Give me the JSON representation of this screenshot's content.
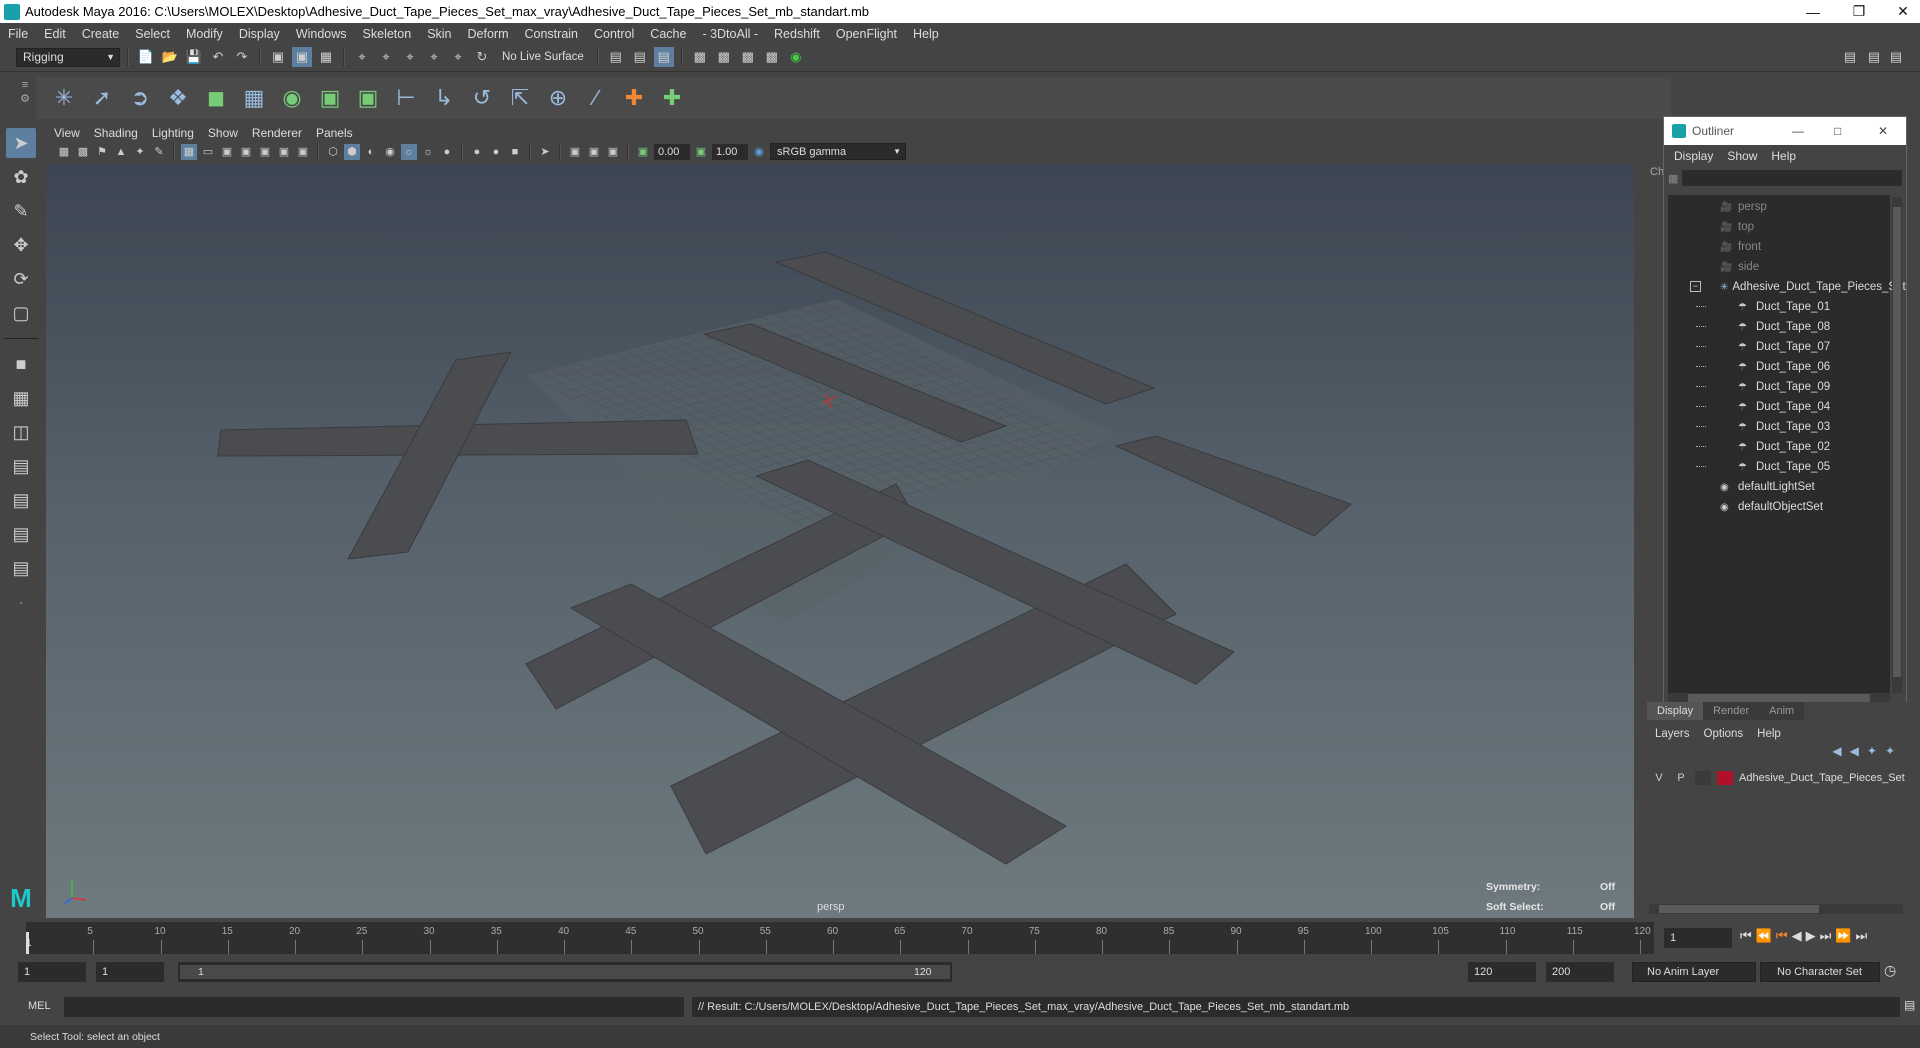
{
  "title": "Autodesk Maya 2016: C:\\Users\\MOLEX\\Desktop\\Adhesive_Duct_Tape_Pieces_Set_max_vray\\Adhesive_Duct_Tape_Pieces_Set_mb_standart.mb",
  "menubar": [
    "File",
    "Edit",
    "Create",
    "Select",
    "Modify",
    "Display",
    "Windows",
    "Skeleton",
    "Skin",
    "Deform",
    "Constrain",
    "Control",
    "Cache",
    "- 3DtoAll -",
    "Redshift",
    "OpenFlight",
    "Help"
  ],
  "status": {
    "menu_set": "Rigging",
    "live_surface": "No Live Surface"
  },
  "panel_menu": [
    "View",
    "Shading",
    "Lighting",
    "Show",
    "Renderer",
    "Panels"
  ],
  "panel_toolbar": {
    "exposure": "0.00",
    "gamma": "1.00",
    "color_space": "sRGB gamma"
  },
  "viewport": {
    "camera": "persp",
    "symmetry_label": "Symmetry:",
    "symmetry_value": "Off",
    "soft_select_label": "Soft Select:",
    "soft_select_value": "Off"
  },
  "outliner": {
    "title": "Outliner",
    "menu": [
      "Display",
      "Show",
      "Help"
    ],
    "items": [
      {
        "label": "persp",
        "icon": "camera-icon",
        "indent": 0,
        "dim": true
      },
      {
        "label": "top",
        "icon": "camera-icon",
        "indent": 0,
        "dim": true
      },
      {
        "label": "front",
        "icon": "camera-icon",
        "indent": 0,
        "dim": true
      },
      {
        "label": "side",
        "icon": "camera-icon",
        "indent": 0,
        "dim": true
      },
      {
        "label": "Adhesive_Duct_Tape_Pieces_Set",
        "icon": "group-icon",
        "indent": 0,
        "dim": false
      },
      {
        "label": "Duct_Tape_01",
        "icon": "mesh-icon",
        "indent": 1,
        "dim": false
      },
      {
        "label": "Duct_Tape_08",
        "icon": "mesh-icon",
        "indent": 1,
        "dim": false
      },
      {
        "label": "Duct_Tape_07",
        "icon": "mesh-icon",
        "indent": 1,
        "dim": false
      },
      {
        "label": "Duct_Tape_06",
        "icon": "mesh-icon",
        "indent": 1,
        "dim": false
      },
      {
        "label": "Duct_Tape_09",
        "icon": "mesh-icon",
        "indent": 1,
        "dim": false
      },
      {
        "label": "Duct_Tape_04",
        "icon": "mesh-icon",
        "indent": 1,
        "dim": false
      },
      {
        "label": "Duct_Tape_03",
        "icon": "mesh-icon",
        "indent": 1,
        "dim": false
      },
      {
        "label": "Duct_Tape_02",
        "icon": "mesh-icon",
        "indent": 1,
        "dim": false
      },
      {
        "label": "Duct_Tape_05",
        "icon": "mesh-icon",
        "indent": 1,
        "dim": false
      },
      {
        "label": "defaultLightSet",
        "icon": "set-icon",
        "indent": 0,
        "dim": false
      },
      {
        "label": "defaultObjectSet",
        "icon": "set-icon",
        "indent": 0,
        "dim": false
      }
    ]
  },
  "layers": {
    "tabs": [
      "Display",
      "Render",
      "Anim"
    ],
    "menu": [
      "Layers",
      "Options",
      "Help"
    ],
    "rows": [
      {
        "v": "V",
        "p": "P",
        "name": "Adhesive_Duct_Tape_Pieces_Set",
        "color": "#b0102a"
      }
    ]
  },
  "timeline": {
    "ticks": [
      "5",
      "10",
      "15",
      "20",
      "25",
      "30",
      "35",
      "40",
      "45",
      "50",
      "55",
      "60",
      "65",
      "70",
      "75",
      "80",
      "85",
      "90",
      "95",
      "100",
      "105",
      "110",
      "115",
      "120"
    ],
    "start_label": "1",
    "current_frame": "1"
  },
  "range": {
    "start": "1",
    "playback_start": "1",
    "slider_start": "1",
    "slider_end": "120",
    "playback_end": "120",
    "end": "200",
    "anim_layer": "No Anim Layer",
    "character_set": "No Character Set"
  },
  "command": {
    "lang": "MEL",
    "result": "// Result: C:/Users/MOLEX/Desktop/Adhesive_Duct_Tape_Pieces_Set_max_vray/Adhesive_Duct_Tape_Pieces_Set_mb_standart.mb"
  },
  "helpline": "Select Tool: select an object",
  "colors": {
    "accent": "#5ea0d8",
    "layer": "#b0102a",
    "manipulator_red": "#d03030"
  }
}
